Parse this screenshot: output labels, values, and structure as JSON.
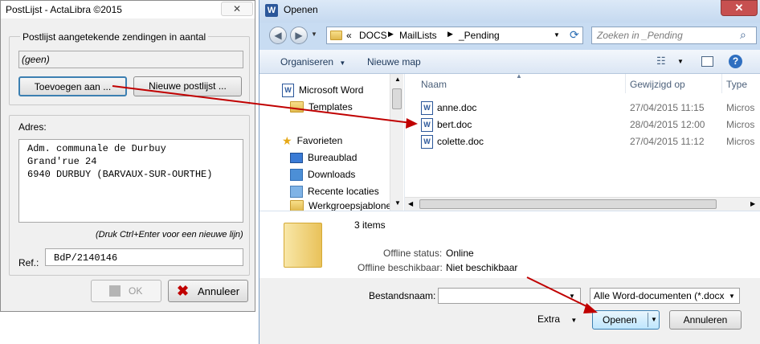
{
  "postlijst": {
    "title": "PostLijst - ActaLibra ©2015",
    "group_label": "Postlijst aangetekende zendingen in aantal",
    "list_value": "(geen)",
    "add_button": "Toevoegen aan ...",
    "new_list_button": "Nieuwe postlijst ...",
    "address_label": "Adres:",
    "address_lines": [
      "Adm. communale de Durbuy",
      "Grand'rue 24",
      "6940 DURBUY (BARVAUX-SUR-OURTHE)"
    ],
    "hint": "(Druk Ctrl+Enter voor een nieuwe lijn)",
    "ref_label": "Ref.:",
    "ref_value": "BdP/2140146",
    "ok_button": "OK",
    "cancel_button": "Annuleer"
  },
  "openen": {
    "title": "Openen",
    "word_icon_letter": "W",
    "close_glyph": "✕",
    "path": {
      "overflow": "«",
      "parts": [
        "DOCS",
        "MailLists",
        "_Pending"
      ]
    },
    "search_placeholder": "Zoeken in _Pending",
    "toolbar": {
      "organize": "Organiseren",
      "new_folder": "Nieuwe map"
    },
    "nav": [
      {
        "label": "Microsoft Word",
        "icon": "word-icon"
      },
      {
        "label": "Templates",
        "icon": "folder-icon"
      },
      {
        "label": "Favorieten",
        "icon": "star-icon"
      },
      {
        "label": "Bureaublad",
        "icon": "desktop-icon"
      },
      {
        "label": "Downloads",
        "icon": "downloads-icon"
      },
      {
        "label": "Recente locaties",
        "icon": "recent-icon"
      },
      {
        "label": "Werkgroepsjablone",
        "icon": "folder-icon"
      }
    ],
    "columns": {
      "name": "Naam",
      "modified": "Gewijzigd op",
      "type": "Type"
    },
    "files": [
      {
        "name": "anne.doc",
        "modified": "27/04/2015 11:15",
        "type": "Micros"
      },
      {
        "name": "bert.doc",
        "modified": "28/04/2015 12:00",
        "type": "Micros"
      },
      {
        "name": "colette.doc",
        "modified": "27/04/2015 11:12",
        "type": "Micros"
      }
    ],
    "details": {
      "count": "3 items",
      "offline_status_label": "Offline status:",
      "offline_status_value": "Online",
      "offline_avail_label": "Offline beschikbaar:",
      "offline_avail_value": "Niet beschikbaar"
    },
    "filename_label": "Bestandsnaam:",
    "filename_value": "",
    "filter_value": "Alle Word-documenten (*.docx",
    "extra_label": "Extra",
    "open_button": "Openen",
    "cancel_button": "Annuleren"
  },
  "colors": {
    "arrow": "#c00000",
    "titlebar": "#dce9f7",
    "close": "#c75050"
  }
}
